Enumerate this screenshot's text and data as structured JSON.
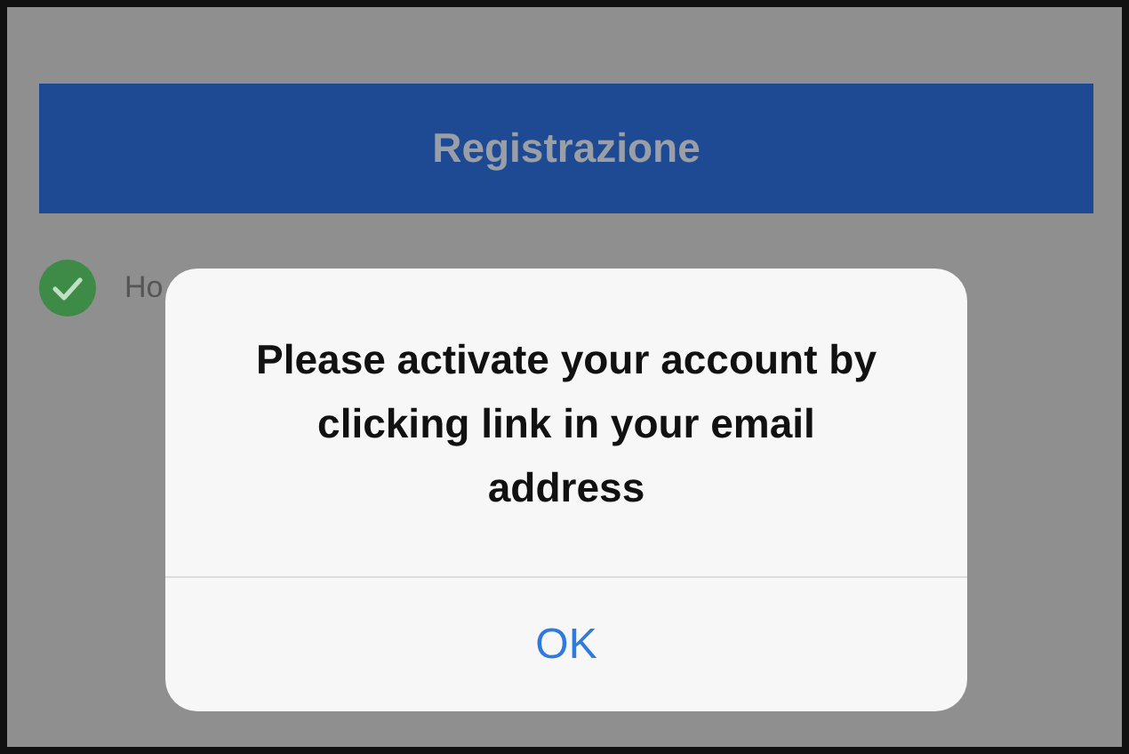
{
  "register_button": {
    "label": "Registrazione"
  },
  "agreement": {
    "checked": true,
    "label": "Ho"
  },
  "alert": {
    "message": "Please activate your account by clicking link in your email address",
    "buttons": [
      {
        "label": "OK"
      }
    ]
  }
}
